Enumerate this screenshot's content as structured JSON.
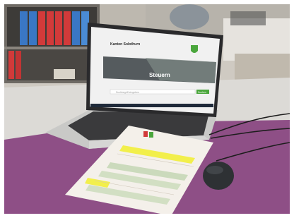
{
  "scene": {
    "description_hidden": "",
    "laptop_screen": {
      "site_title": "Kanton Solothurn",
      "hero_heading": "Steuern",
      "search_placeholder": "Suchbegriff eingeben",
      "search_button": "Suchen"
    },
    "colors": {
      "desk_mat": "#8e4f86",
      "table": "#dcdad6",
      "laptop_body": "#c9c9c7",
      "screen_bg": "#f1f1f1",
      "highlight_yellow": "#f2ee3a",
      "form_green": "#a9c995",
      "mouse": "#2e3134",
      "crest_green": "#4aa63c"
    }
  }
}
